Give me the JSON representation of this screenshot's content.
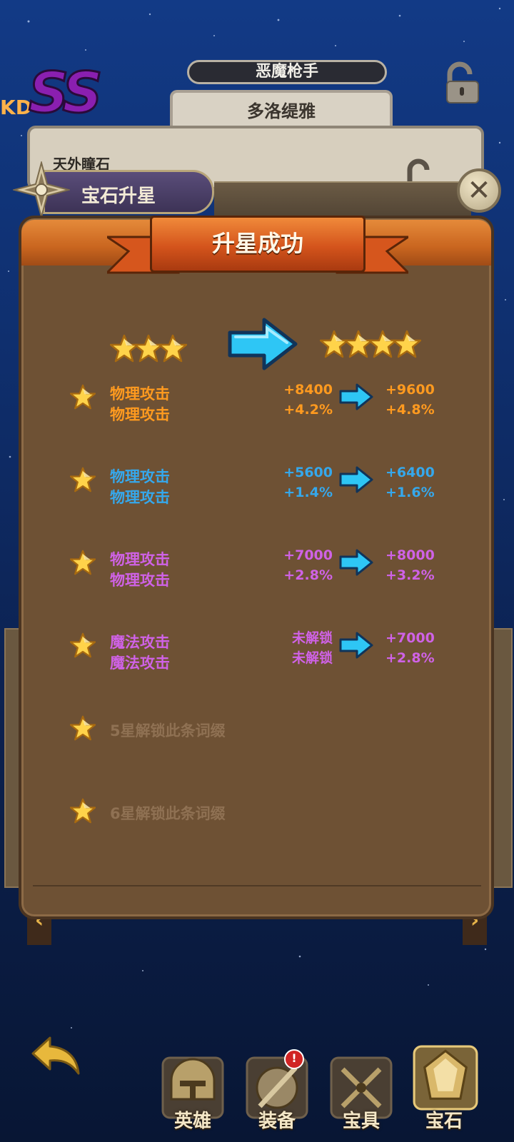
{
  "colors": {
    "orange": "#ff9a1f",
    "blue": "#35a8ec",
    "purple": "#cf62e6",
    "locked": "#8f7153"
  },
  "header": {
    "rank_prefix": "KD",
    "rank": "SS",
    "hero_title": "恶魔枪手",
    "hero_name": "多洛缇雅",
    "item_name": "天外瞳石"
  },
  "dialog": {
    "section_label": "宝石升星",
    "banner_title": "升星成功",
    "stars_before": 3,
    "stars_after": 4
  },
  "attributes": [
    {
      "name1": "物理攻击",
      "name2": "物理攻击",
      "color": "#ff9a1f",
      "old1": "+8400",
      "old2": "+4.2%",
      "new1": "+9600",
      "new2": "+4.8%"
    },
    {
      "name1": "物理攻击",
      "name2": "物理攻击",
      "color": "#35a8ec",
      "old1": "+5600",
      "old2": "+1.4%",
      "new1": "+6400",
      "new2": "+1.6%"
    },
    {
      "name1": "物理攻击",
      "name2": "物理攻击",
      "color": "#cf62e6",
      "old1": "+7000",
      "old2": "+2.8%",
      "new1": "+8000",
      "new2": "+3.2%"
    },
    {
      "name1": "魔法攻击",
      "name2": "魔法攻击",
      "color": "#cf62e6",
      "old1": "未解锁",
      "old2": "未解锁",
      "new1": "+7000",
      "new2": "+2.8%"
    }
  ],
  "locked_rows": [
    {
      "text": "5星解锁此条词缀"
    },
    {
      "text": "6星解锁此条词缀"
    }
  ],
  "nav": {
    "back_icon": "back-arrow-icon",
    "items": [
      {
        "label": "英雄",
        "icon": "helmet-icon"
      },
      {
        "label": "装备",
        "icon": "shield-sword-icon",
        "badge": "!"
      },
      {
        "label": "宝具",
        "icon": "crossed-swords-icon"
      },
      {
        "label": "宝石",
        "icon": "gem-icon"
      }
    ]
  }
}
